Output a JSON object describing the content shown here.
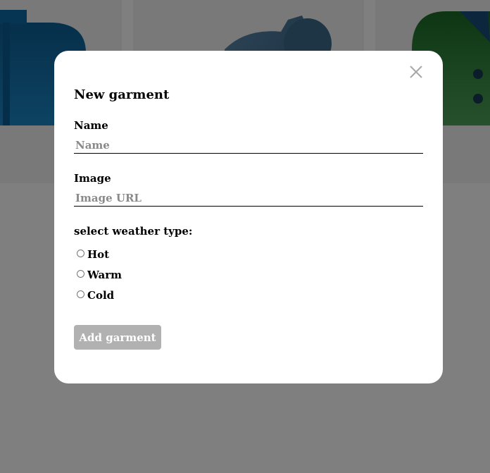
{
  "modal": {
    "title": "New garment",
    "close_icon": "close-icon",
    "name_label": "Name",
    "name_placeholder": "Name",
    "image_label": "Image",
    "image_placeholder": "Image URL",
    "weather_title": "select weather type:",
    "weather_options": [
      "Hot",
      "Warm",
      "Cold"
    ],
    "submit_label": "Add garment"
  },
  "background_cards": [
    {
      "icon": "shirt-icon"
    },
    {
      "icon": "cap-icon"
    },
    {
      "icon": "jacket-icon"
    }
  ],
  "colors": {
    "overlay": "rgba(0,0,0,0.5)",
    "submit_disabled": "#b1b1b1",
    "shirt": "#0f75b8",
    "cap": "#4b7a9c",
    "jacket": "#1f7a2e"
  }
}
